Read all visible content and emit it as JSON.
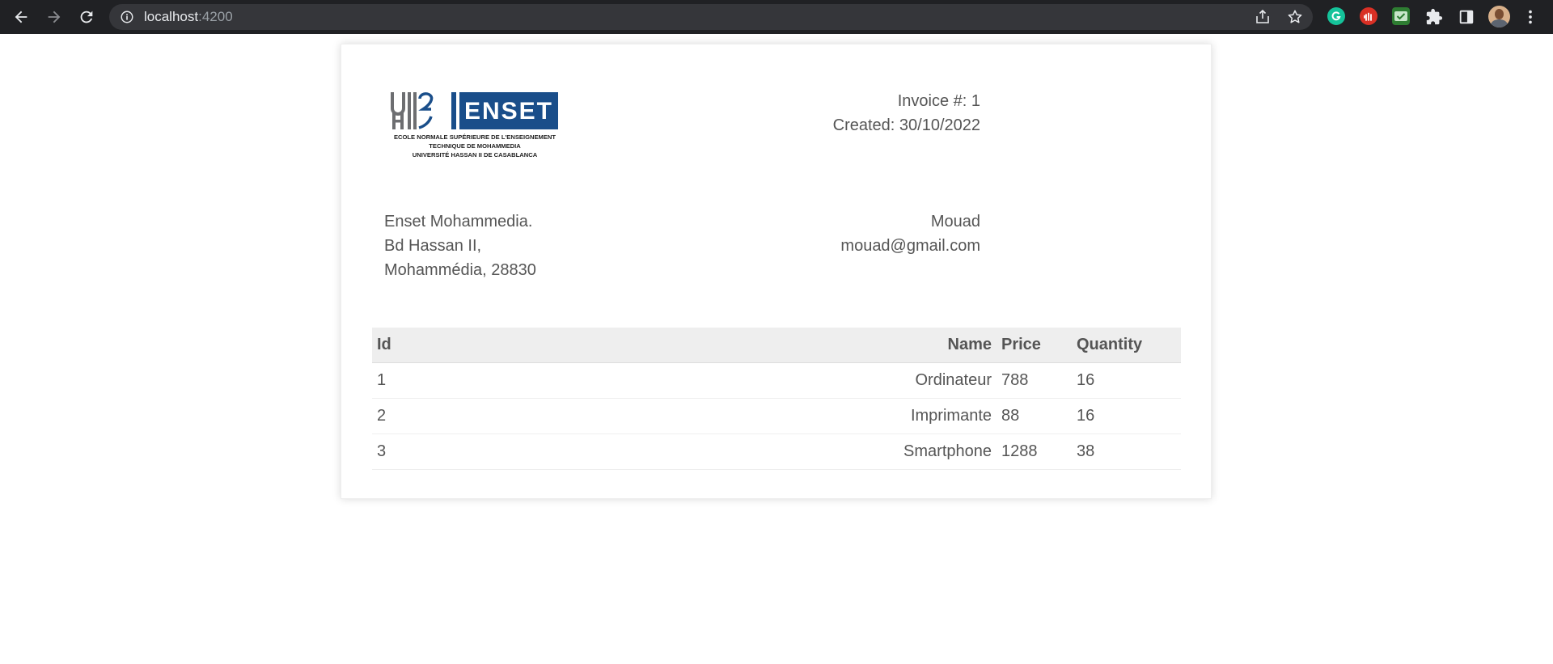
{
  "browser": {
    "url_host": "localhost",
    "url_port": ":4200",
    "nav_buttons": [
      "back-icon",
      "forward-icon",
      "reload-icon"
    ],
    "address_icons": [
      "info-icon",
      "share-icon",
      "star-icon"
    ],
    "extensions": [
      "grammarly-icon",
      "block-icon",
      "mail-check-icon",
      "puzzle-icon",
      "side-panel-icon"
    ],
    "colors": {
      "chrome": "#202124",
      "omnibox": "#35363a",
      "grammarly": "#15c39a",
      "block": "#d93025"
    }
  },
  "invoice": {
    "logo": {
      "mark": "UH2C",
      "name": "ENSET",
      "line1": "ECOLE NORMALE SUPÉRIEURE DE L'ENSEIGNEMENT",
      "line2": "TECHNIQUE DE MOHAMMEDIA",
      "line3": "UNIVERSITÉ HASSAN II DE CASABLANCA",
      "brand_color": "#1a4e8a"
    },
    "number_label": "Invoice #: 1",
    "created_label": "Created: 30/10/2022",
    "company": {
      "name": "Enset Mohammedia.",
      "street": "Bd Hassan II,",
      "city": "Mohammédia, 28830"
    },
    "client": {
      "name": "Mouad",
      "email": "mouad@gmail.com"
    },
    "table": {
      "headers": [
        "Id",
        "Name",
        "Price",
        "Quantity"
      ],
      "rows": [
        {
          "id": "1",
          "name": "Ordinateur",
          "price": "788",
          "quantity": "16"
        },
        {
          "id": "2",
          "name": "Imprimante",
          "price": "88",
          "quantity": "16"
        },
        {
          "id": "3",
          "name": "Smartphone",
          "price": "1288",
          "quantity": "38"
        }
      ]
    }
  }
}
